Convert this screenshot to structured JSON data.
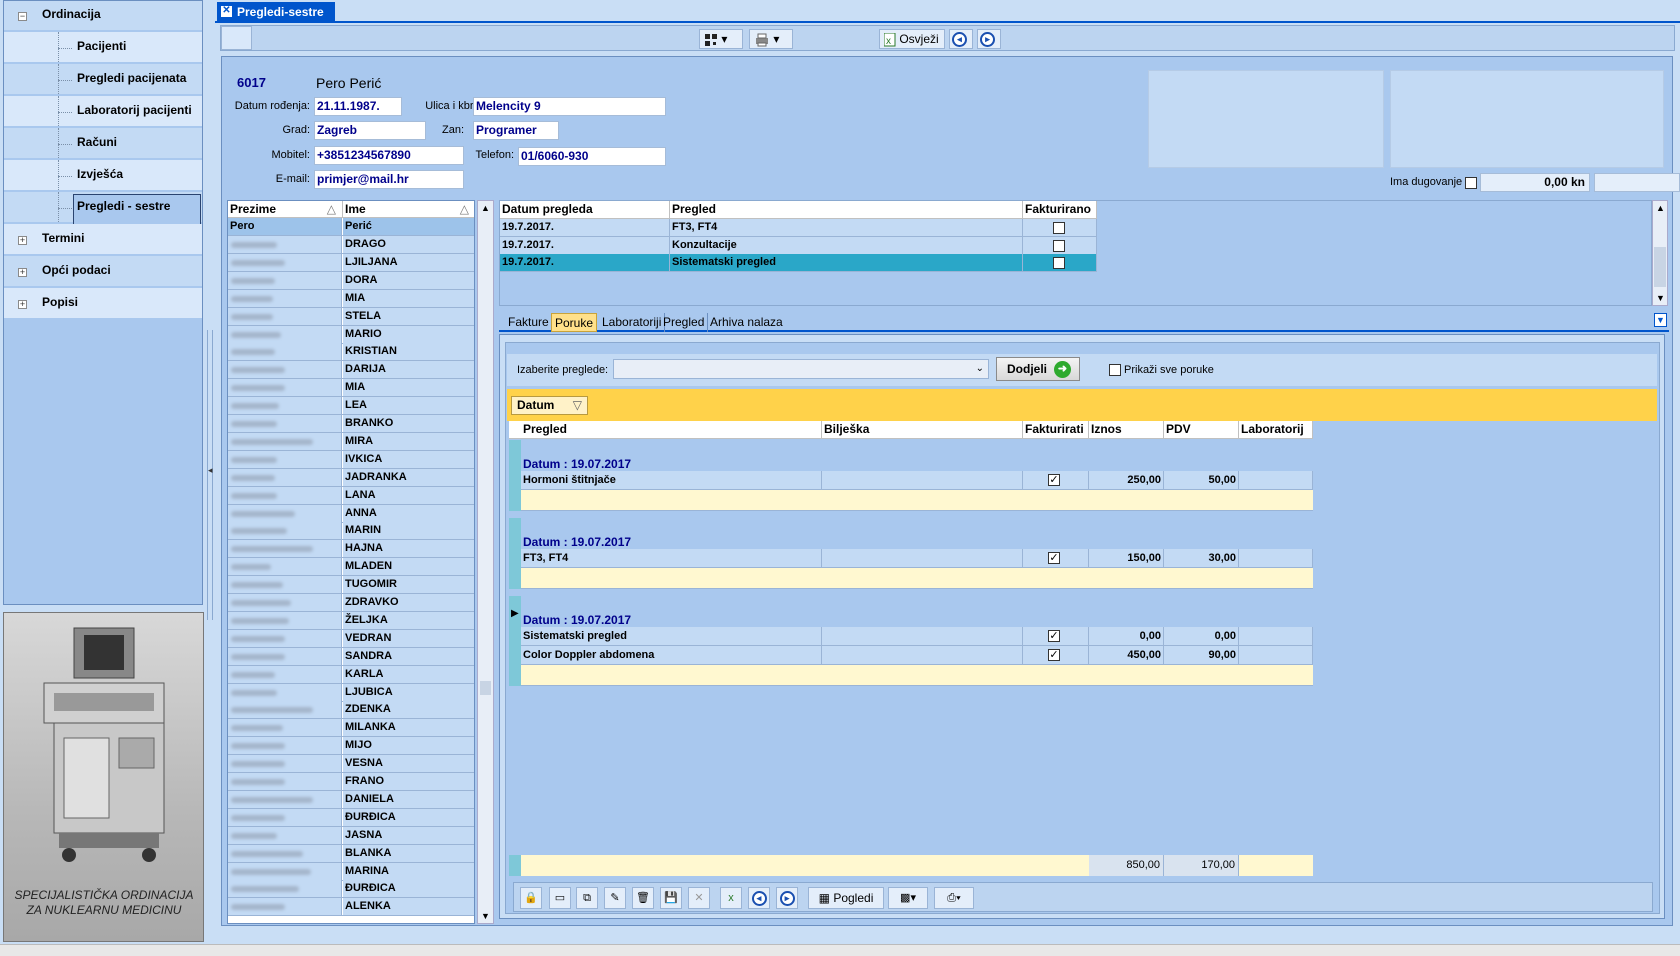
{
  "tree": {
    "items": [
      {
        "label": "Ordinacija",
        "level": 0,
        "expanded": true
      },
      {
        "label": "Pacijenti",
        "level": 1
      },
      {
        "label": "Pregledi pacijenata",
        "level": 1
      },
      {
        "label": "Laboratorij pacijenti",
        "level": 1
      },
      {
        "label": "Računi",
        "level": 1
      },
      {
        "label": "Izvješća",
        "level": 1
      },
      {
        "label": "Pregledi - sestre",
        "level": 1,
        "selected": true
      },
      {
        "label": "Termini",
        "level": 0,
        "expanded": false
      },
      {
        "label": "Opći podaci",
        "level": 0,
        "expanded": false
      },
      {
        "label": "Popisi",
        "level": 0,
        "expanded": false
      }
    ]
  },
  "banner": {
    "line1": "SPECIJALISTIČKA ORDINACIJA",
    "line2": "ZA NUKLEARNU MEDICINU"
  },
  "tab": {
    "title": "Pregledi-sestre",
    "close": "✕"
  },
  "toolbar": {
    "refresh": "Osvježi"
  },
  "patient": {
    "id": "6017",
    "name": "Pero Perić",
    "dob_label": "Datum rođenja:",
    "dob": "21.11.1987.",
    "street_label": "Ulica i kbr.:",
    "street": "Melencity 9",
    "city_label": "Grad:",
    "city": "Zagreb",
    "job_label": "Zan:",
    "job": "Programer",
    "mobile_label": "Mobitel:",
    "mobile": "+3851234567890",
    "phone_label": "Telefon:",
    "phone": "01/6060-930",
    "email_label": "E-mail:",
    "email": "primjer@mail.hr",
    "debt_label": "Ima dugovanje",
    "debt_amount": "0,00 kn"
  },
  "patient_grid": {
    "headers": {
      "surname": "Prezime",
      "name": "Ime"
    },
    "selected": {
      "surname": "Pero",
      "name": "Perić"
    },
    "names": [
      "DRAGO",
      "LJILJANA",
      "DORA",
      "MIA",
      "STELA",
      "MARIO",
      "KRISTIAN",
      "DARIJA",
      "MIA",
      "LEA",
      "BRANKO",
      "MIRA",
      "IVKICA",
      "JADRANKA",
      "LANA",
      "ANNA",
      "MARIN",
      "HAJNA",
      "MLADEN",
      "TUGOMIR",
      "ZDRAVKO",
      "ŽELJKA",
      "VEDRAN",
      "SANDRA",
      "KARLA",
      "LJUBICA",
      "ZDENKA",
      "MILANKA",
      "MIJO",
      "VESNA",
      "FRANO",
      "DANIELA",
      "ĐURĐICA",
      "JASNA",
      "BLANKA",
      "MARINA",
      "ĐURĐICA",
      "ALENKA"
    ]
  },
  "exam_grid": {
    "headers": {
      "date": "Datum pregleda",
      "exam": "Pregled",
      "invoiced": "Fakturirano"
    },
    "rows": [
      {
        "date": "19.7.2017.",
        "exam": "FT3, FT4",
        "invoiced": false
      },
      {
        "date": "19.7.2017.",
        "exam": "Konzultacije",
        "invoiced": false
      },
      {
        "date": "19.7.2017.",
        "exam": "Sistematski pregled",
        "invoiced": false,
        "selected": true
      }
    ]
  },
  "subtabs": [
    "Fakture",
    "Poruke",
    "Laboratoriji",
    "Pregled",
    "Arhiva nalaza"
  ],
  "subtab_active": "Poruke",
  "messages": {
    "select_label": "Izaberite preglede:",
    "assign_button": "Dodjeli",
    "show_all_label": "Prikaži sve poruke",
    "group_chip": "Datum",
    "headers": {
      "exam": "Pregled",
      "note": "Bilješka",
      "invoice": "Fakturirati",
      "amount": "Iznos",
      "vat": "PDV",
      "lab": "Laboratorij"
    },
    "groups": [
      {
        "title": "Datum : 19.07.2017",
        "rows": [
          {
            "exam": "Hormoni štitnjače",
            "note": "",
            "invoice": true,
            "amount": "250,00",
            "vat": "50,00",
            "lab": ""
          }
        ]
      },
      {
        "title": "Datum : 19.07.2017",
        "rows": [
          {
            "exam": "FT3, FT4",
            "note": "",
            "invoice": true,
            "amount": "150,00",
            "vat": "30,00",
            "lab": ""
          }
        ]
      },
      {
        "title": "Datum : 19.07.2017",
        "rows": [
          {
            "exam": "Sistematski pregled",
            "note": "",
            "invoice": true,
            "amount": "0,00",
            "vat": "0,00",
            "lab": ""
          },
          {
            "exam": "Color Doppler abdomena",
            "note": "",
            "invoice": true,
            "amount": "450,00",
            "vat": "90,00",
            "lab": ""
          }
        ]
      }
    ],
    "totals": {
      "amount": "850,00",
      "vat": "170,00"
    }
  },
  "bottombar": {
    "views": "Pogledi"
  }
}
